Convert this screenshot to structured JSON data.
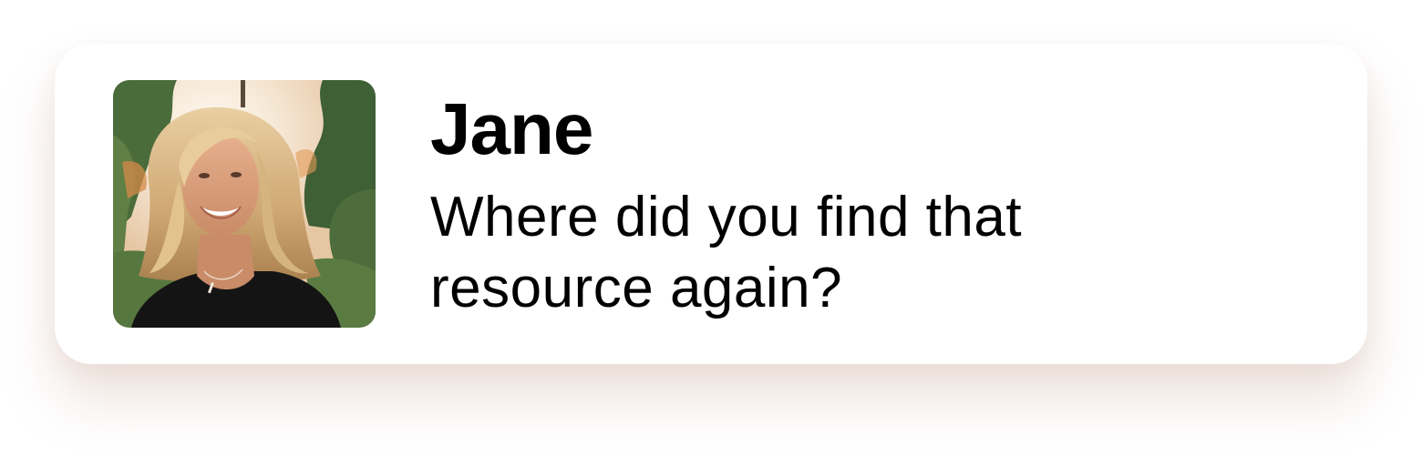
{
  "message_card": {
    "sender_name": "Jane",
    "message_text": "Where did you find that resource again?",
    "avatar_icon": "profile-photo-icon"
  },
  "colors": {
    "card_background": "#ffffff",
    "text": "#000000",
    "shadow_tint": "#b08068"
  }
}
